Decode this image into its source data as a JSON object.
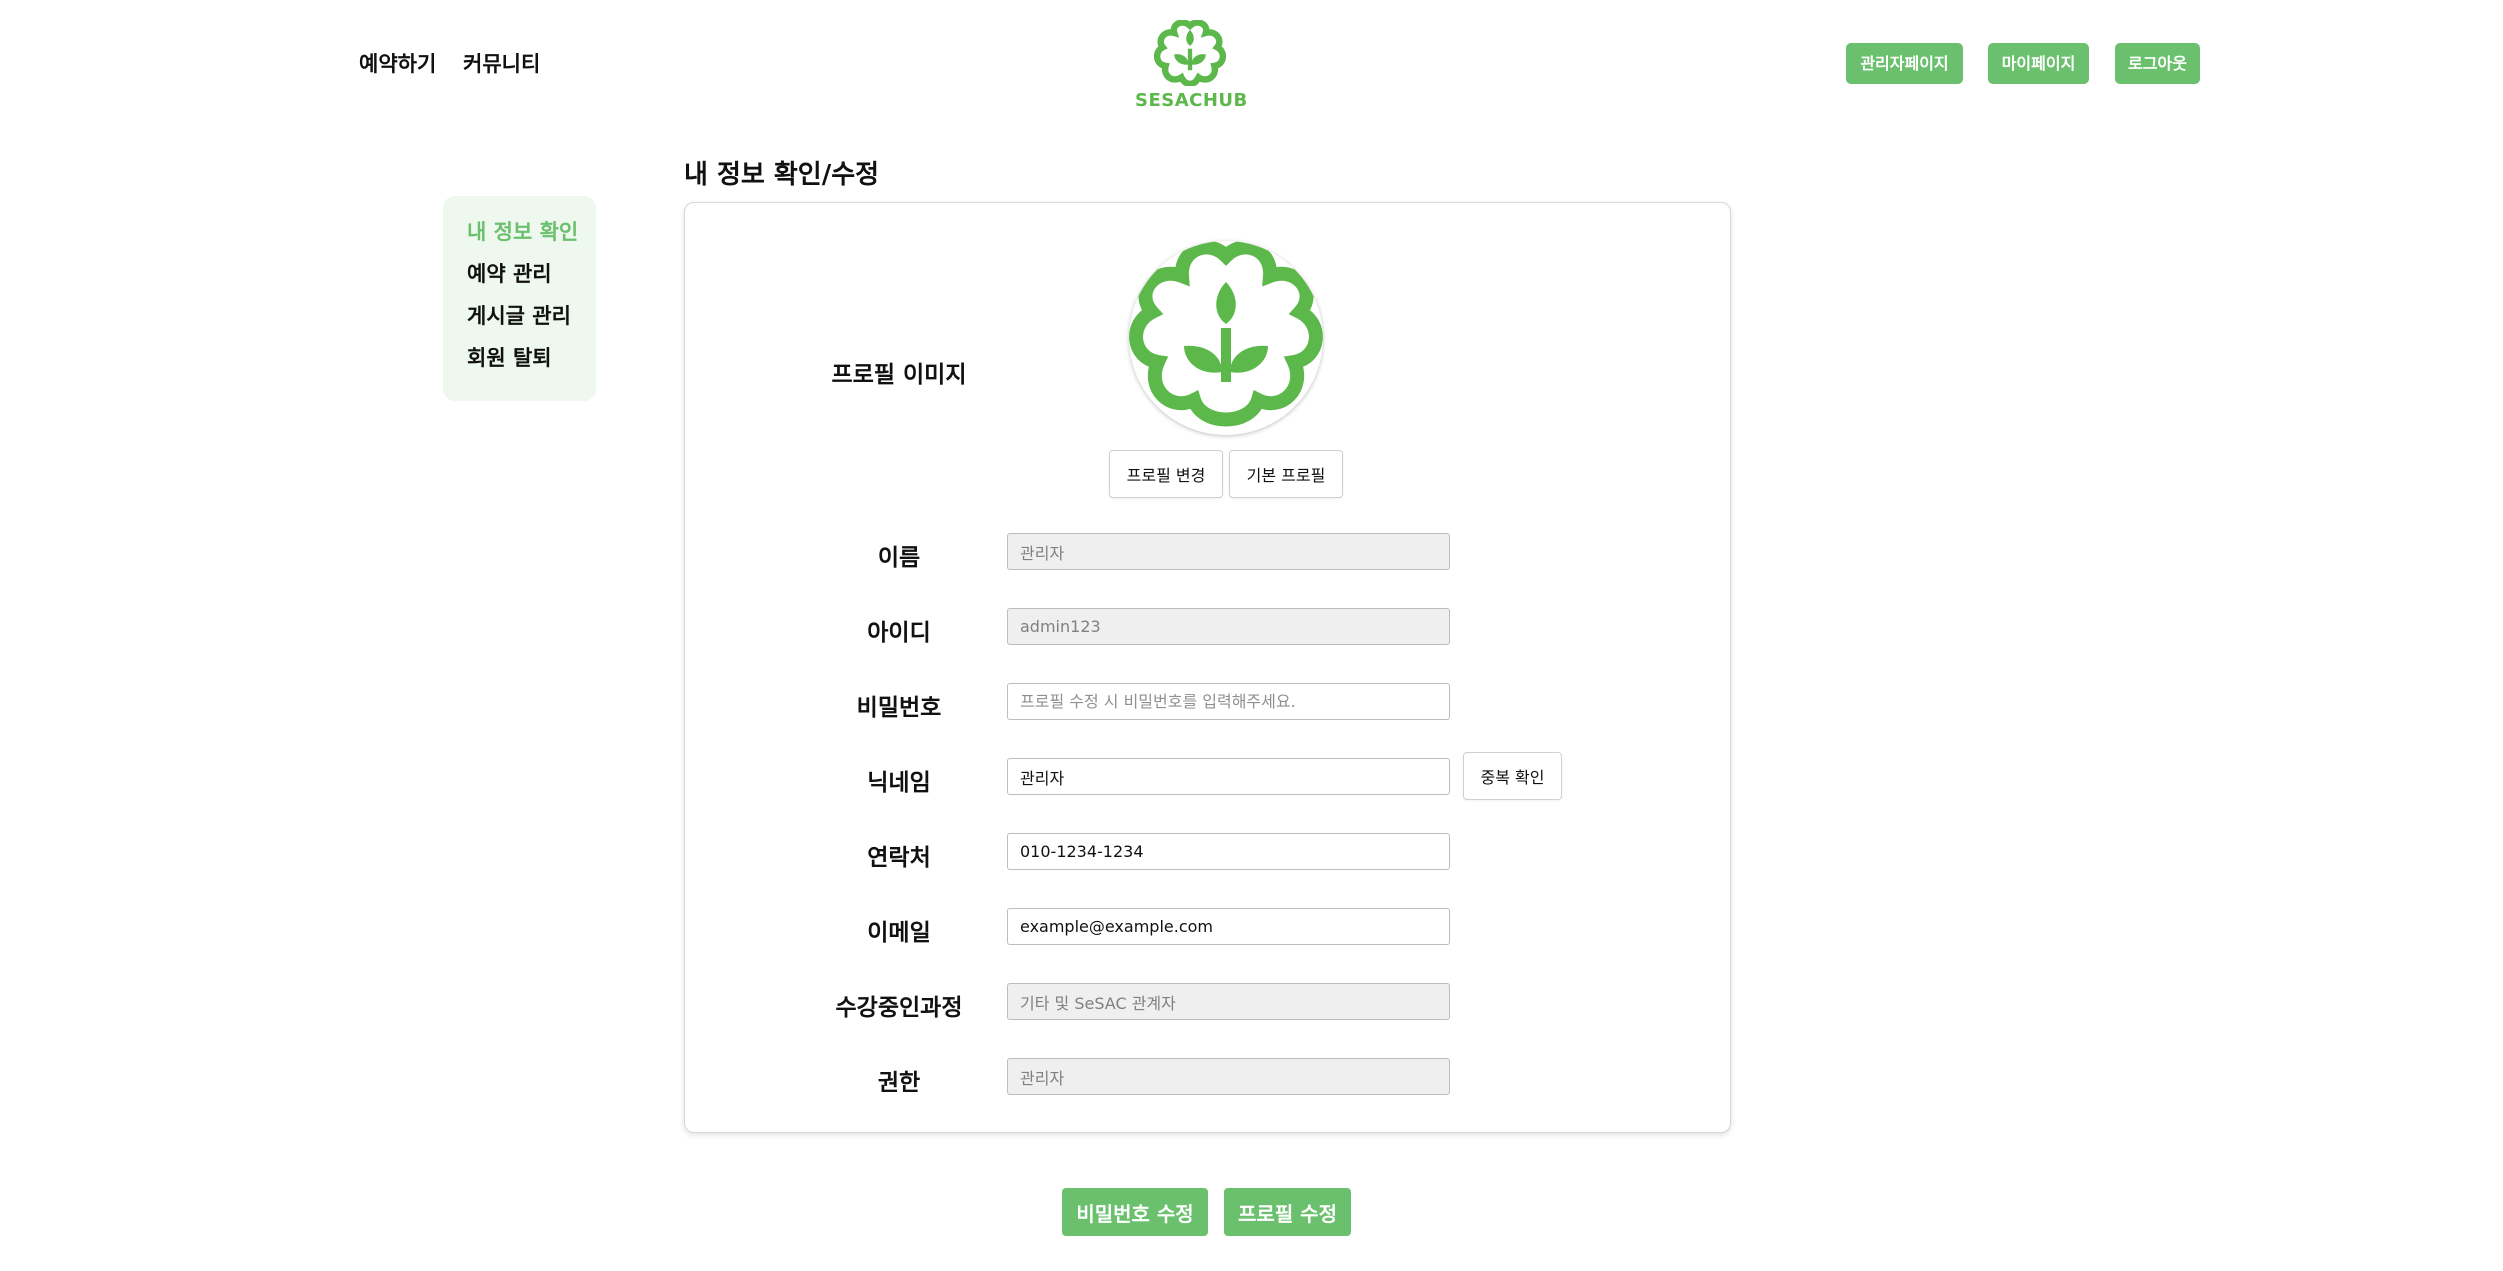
{
  "header": {
    "nav": [
      "예약하기",
      "커뮤니티"
    ],
    "logo_text": "SESACHUB",
    "buttons": {
      "admin": "관리자페이지",
      "mypage": "마이페이지",
      "logout": "로그아웃"
    }
  },
  "sidebar": {
    "items": [
      {
        "label": "내 정보 확인",
        "active": true
      },
      {
        "label": "예약 관리",
        "active": false
      },
      {
        "label": "게시글 관리",
        "active": false
      },
      {
        "label": "회원 탈퇴",
        "active": false
      }
    ]
  },
  "page": {
    "title": "내 정보 확인/수정"
  },
  "profile": {
    "label": "프로필 이미지",
    "change_button": "프로필 변경",
    "default_button": "기본 프로필",
    "icon": "sprout-cloud-logo"
  },
  "form": {
    "name": {
      "label": "이름",
      "value": "관리자"
    },
    "user_id": {
      "label": "아이디",
      "value": "admin123"
    },
    "password": {
      "label": "비밀번호",
      "placeholder": "프로필 수정 시 비밀번호를 입력해주세요."
    },
    "nickname": {
      "label": "닉네임",
      "value": "관리자",
      "check_button": "중복 확인"
    },
    "phone": {
      "label": "연락처",
      "value": "010-1234-1234"
    },
    "email": {
      "label": "이메일",
      "value": "example@example.com"
    },
    "course": {
      "label": "수강중인과정",
      "value": "기타 및 SeSAC 관계자"
    },
    "role": {
      "label": "권한",
      "value": "관리자"
    }
  },
  "actions": {
    "change_password": "비밀번호 수정",
    "update_profile": "프로필 수정"
  },
  "colors": {
    "accent": "#6bc06e",
    "logo_green": "#5db84b",
    "sidebar_bg": "#eef8ee"
  }
}
